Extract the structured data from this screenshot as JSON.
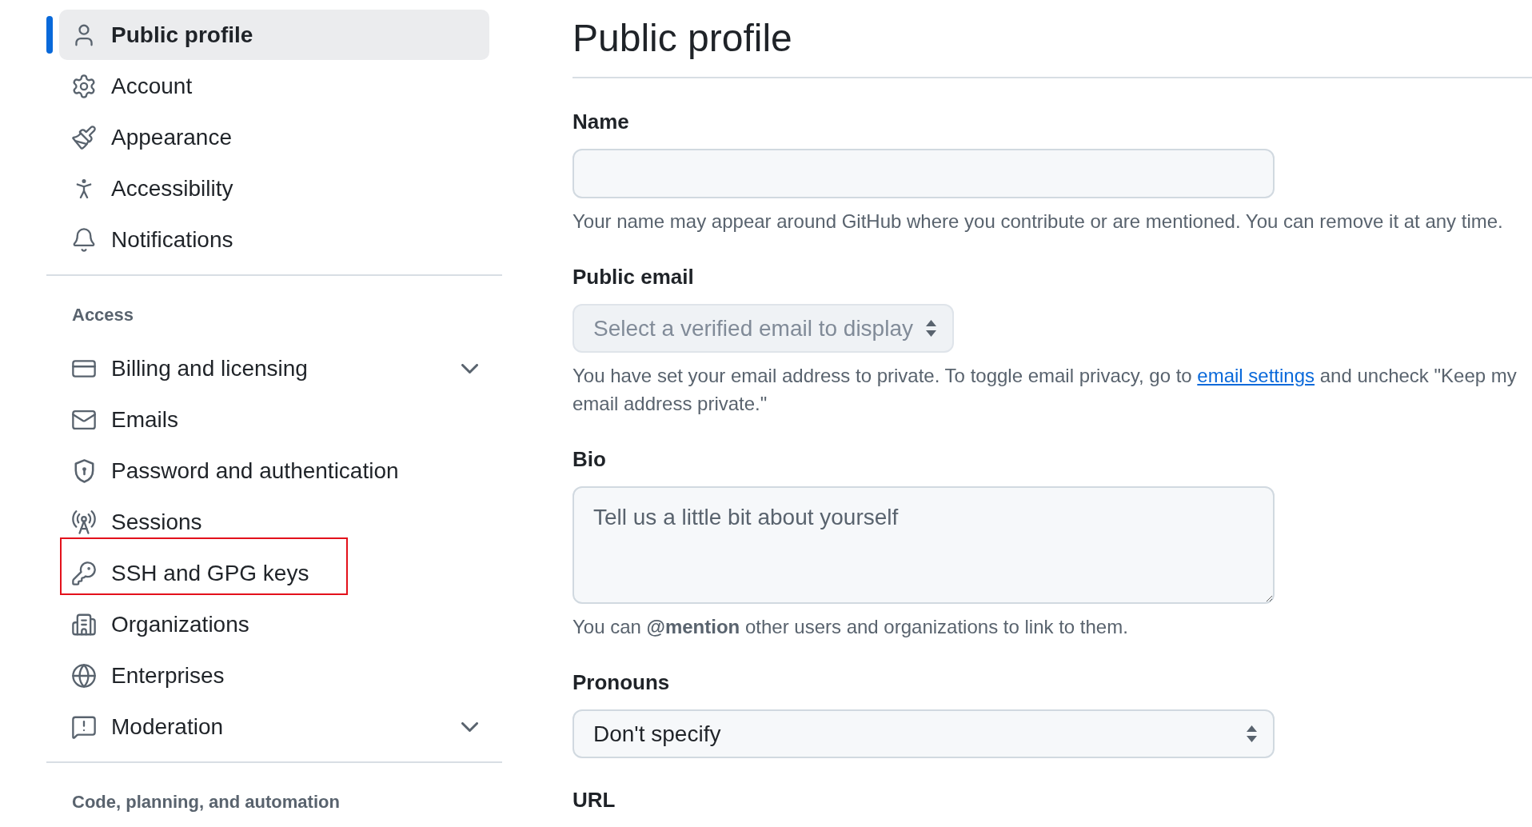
{
  "sidebar": {
    "sections": [
      {
        "items": [
          {
            "label": "Public profile",
            "kind": "link",
            "selected": true,
            "highlighted": false
          },
          {
            "label": "Account",
            "kind": "link",
            "selected": false,
            "highlighted": false
          },
          {
            "label": "Appearance",
            "kind": "link",
            "selected": false,
            "highlighted": false
          },
          {
            "label": "Accessibility",
            "kind": "link",
            "selected": false,
            "highlighted": false
          },
          {
            "label": "Notifications",
            "kind": "link",
            "selected": false,
            "highlighted": false
          }
        ]
      },
      {
        "heading": "Access",
        "items": [
          {
            "label": "Billing and licensing",
            "kind": "group",
            "expanded": false,
            "selected": false,
            "highlighted": false
          },
          {
            "label": "Emails",
            "kind": "link",
            "selected": false,
            "highlighted": false
          },
          {
            "label": "Password and authentication",
            "kind": "link",
            "selected": false,
            "highlighted": false
          },
          {
            "label": "Sessions",
            "kind": "link",
            "selected": false,
            "highlighted": false
          },
          {
            "label": "SSH and GPG keys",
            "kind": "link",
            "selected": false,
            "highlighted": true
          },
          {
            "label": "Organizations",
            "kind": "link",
            "selected": false,
            "highlighted": false
          },
          {
            "label": "Enterprises",
            "kind": "link",
            "selected": false,
            "highlighted": false
          },
          {
            "label": "Moderation",
            "kind": "group",
            "expanded": false,
            "selected": false,
            "highlighted": false
          }
        ]
      },
      {
        "heading": "Code, planning, and automation"
      }
    ]
  },
  "main": {
    "title": "Public profile",
    "fields": [
      {
        "kind": "text",
        "label": "Name",
        "help": "Your name may appear around GitHub where you contribute or are mentioned. You can remove it at any time."
      },
      {
        "kind": "inline_select",
        "label": "Public email",
        "value": "Select a verified email to display",
        "disabled": true,
        "help": "You have set your email address to private. To toggle email privacy, go to ",
        "help_link": "email settings",
        "help_after": " and uncheck \"Keep my email address private.\""
      },
      {
        "kind": "textarea",
        "label": "Bio",
        "placeholder": "Tell us a little bit about yourself",
        "help": "You can **@mention** other users and organizations to link to them."
      },
      {
        "kind": "wide_select",
        "label": "Pronouns",
        "value": "Don't specify",
        "disabled": false
      },
      {
        "label": "URL"
      }
    ]
  }
}
